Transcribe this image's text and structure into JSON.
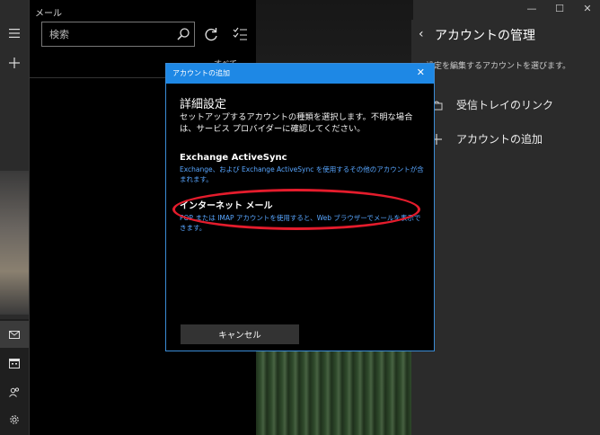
{
  "app": {
    "title": "メール"
  },
  "search": {
    "placeholder": "検索"
  },
  "filter": {
    "label": "すべて ⌄"
  },
  "accounts_pane": {
    "title": "アカウントの管理",
    "description": "設定を編集するアカウントを選びます。",
    "items": [
      {
        "label": "受信トレイのリンク",
        "icon": "link-inbox-icon"
      },
      {
        "label": "アカウントの追加",
        "icon": "plus-icon"
      }
    ]
  },
  "dialog": {
    "title": "アカウントの追加",
    "heading": "詳細設定",
    "description": "セットアップするアカウントの種類を選択します。不明な場合は、サービス プロバイダーに確認してください。",
    "options": [
      {
        "title": "Exchange ActiveSync",
        "text": "Exchange、および Exchange ActiveSync を使用するその他のアカウントが含まれます。"
      },
      {
        "title": "インターネット メール",
        "text": "POP または IMAP アカウントを使用すると、Web ブラウザーでメールを表示できます。"
      }
    ],
    "cancel_label": "キャンセル"
  },
  "colors": {
    "accent": "#1e88e5",
    "highlight": "#e41c2c",
    "link": "#58a6ff"
  }
}
